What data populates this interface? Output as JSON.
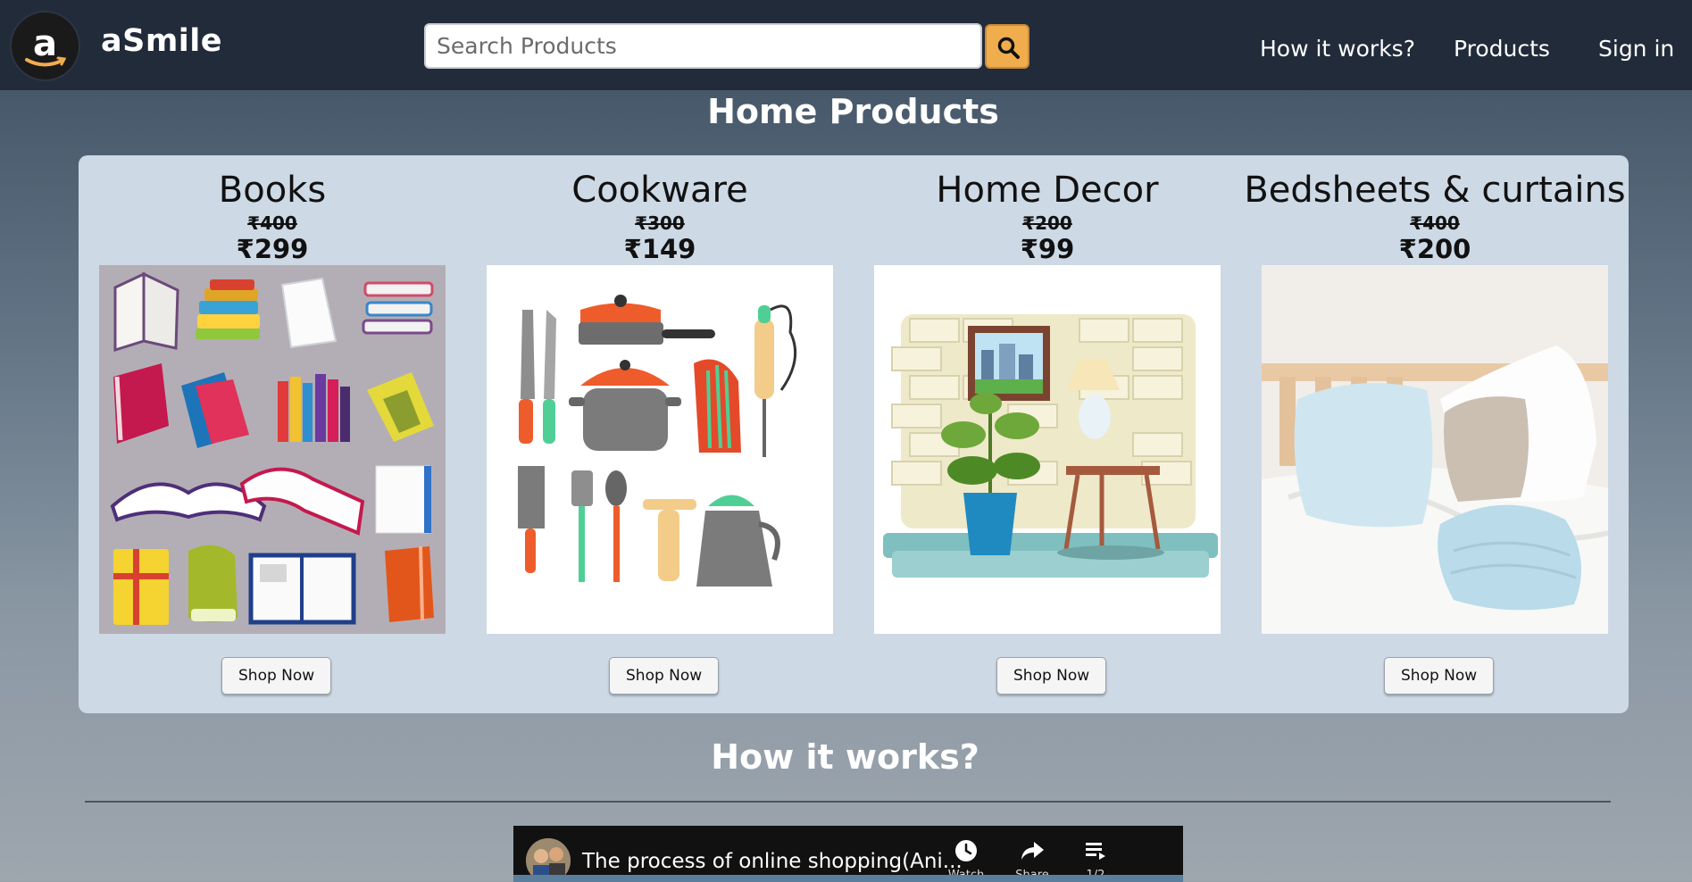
{
  "header": {
    "brand": "aSmile",
    "search_placeholder": "Search Products",
    "nav": [
      "How it works?",
      "Products",
      "Sign in"
    ]
  },
  "home_products": {
    "title": "Home Products",
    "cards": [
      {
        "title": "Books",
        "old_price": "₹400",
        "price": "₹299",
        "button": "Shop Now",
        "image": "books-illustration"
      },
      {
        "title": "Cookware",
        "old_price": "₹300",
        "price": "₹149",
        "button": "Shop Now",
        "image": "cookware-illustration"
      },
      {
        "title": "Home Decor",
        "old_price": "₹200",
        "price": "₹99",
        "button": "Shop Now",
        "image": "home-decor-illustration"
      },
      {
        "title": "Bedsheets & curtains",
        "old_price": "₹400",
        "price": "₹200",
        "button": "Shop Now",
        "image": "bedsheets-photo"
      }
    ]
  },
  "how_it_works": {
    "title": "How it works?",
    "video": {
      "title": "The process of online shopping(Ani...",
      "actions": [
        "Watch later",
        "Share",
        "1/2"
      ]
    }
  },
  "colors": {
    "navbar": "#212b3a",
    "panel": "#cdd9e5",
    "search_button": "#f0ad4e"
  }
}
